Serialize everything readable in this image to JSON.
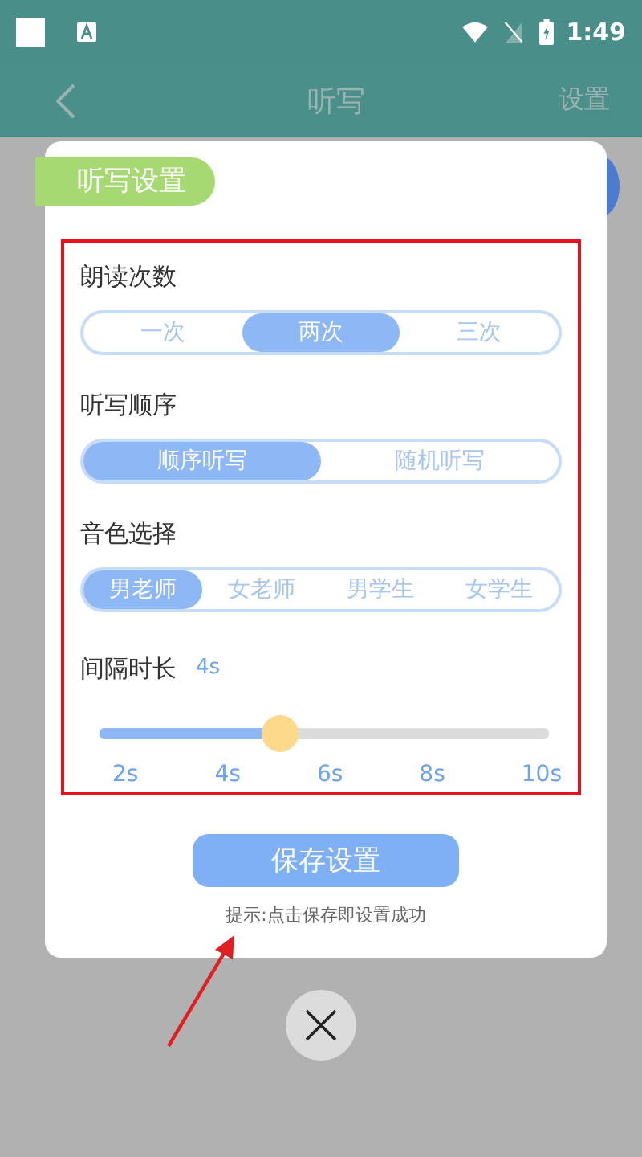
{
  "status_bar": {
    "time": "1:49"
  },
  "app_bar": {
    "title": "听写",
    "action": "设置"
  },
  "dialog": {
    "title": "听写设置",
    "sections": [
      {
        "kind": "segmented",
        "label": "朗读次数",
        "options": [
          {
            "label": "一次",
            "selected": false
          },
          {
            "label": "两次",
            "selected": true
          },
          {
            "label": "三次",
            "selected": false
          }
        ]
      },
      {
        "kind": "segmented",
        "label": "听写顺序",
        "options": [
          {
            "label": "顺序听写",
            "selected": true
          },
          {
            "label": "随机听写",
            "selected": false
          }
        ]
      },
      {
        "kind": "segmented",
        "label": "音色选择",
        "options": [
          {
            "label": "男老师",
            "selected": true
          },
          {
            "label": "女老师",
            "selected": false
          },
          {
            "label": "男学生",
            "selected": false
          },
          {
            "label": "女学生",
            "selected": false
          }
        ]
      },
      {
        "kind": "slider",
        "label": "间隔时长",
        "reading": "4s",
        "level": 0.4,
        "ticks": [
          "2s",
          "4s",
          "6s",
          "8s",
          "10s"
        ]
      }
    ],
    "save_button": "保存设置",
    "hint": "提示:点击保存即设置成功"
  }
}
